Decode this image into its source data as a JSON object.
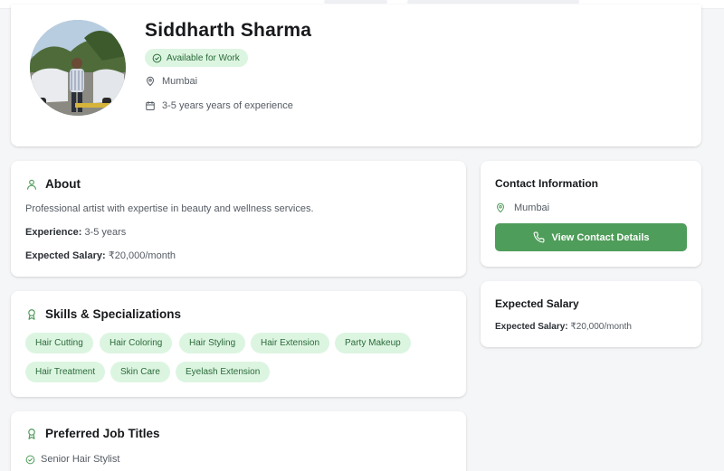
{
  "profile": {
    "name": "Siddharth Sharma",
    "availability": "Available for Work",
    "location": "Mumbai",
    "experience_line": "3-5 years years of experience"
  },
  "about": {
    "title": "About",
    "description": "Professional artist with expertise in beauty and wellness services.",
    "experience_label": "Experience:",
    "experience_value": "3-5 years",
    "salary_label": "Expected Salary:",
    "salary_value": "₹20,000/month"
  },
  "skills": {
    "title": "Skills & Specializations",
    "items": [
      "Hair Cutting",
      "Hair Coloring",
      "Hair Styling",
      "Hair Extension",
      "Party Makeup",
      "Hair Treatment",
      "Skin Care",
      "Eyelash Extension"
    ]
  },
  "jobs": {
    "title": "Preferred Job Titles",
    "items": [
      "Senior Hair Stylist"
    ]
  },
  "contact": {
    "title": "Contact Information",
    "location": "Mumbai",
    "button_label": "View Contact Details"
  },
  "salary_card": {
    "title": "Expected Salary",
    "label": "Expected Salary:",
    "value": "₹20,000/month"
  },
  "icons": {
    "badge": "check-circle-icon",
    "location": "map-pin-icon",
    "experience": "calendar-icon",
    "about": "user-icon",
    "skills": "award-icon",
    "jobs": "award-icon",
    "contact_button": "phone-icon"
  },
  "colors": {
    "accent": "#4f9d5a",
    "chip_bg": "#dcf5e1",
    "chip_text": "#2b6b39",
    "page_bg": "#f5f6f8"
  }
}
